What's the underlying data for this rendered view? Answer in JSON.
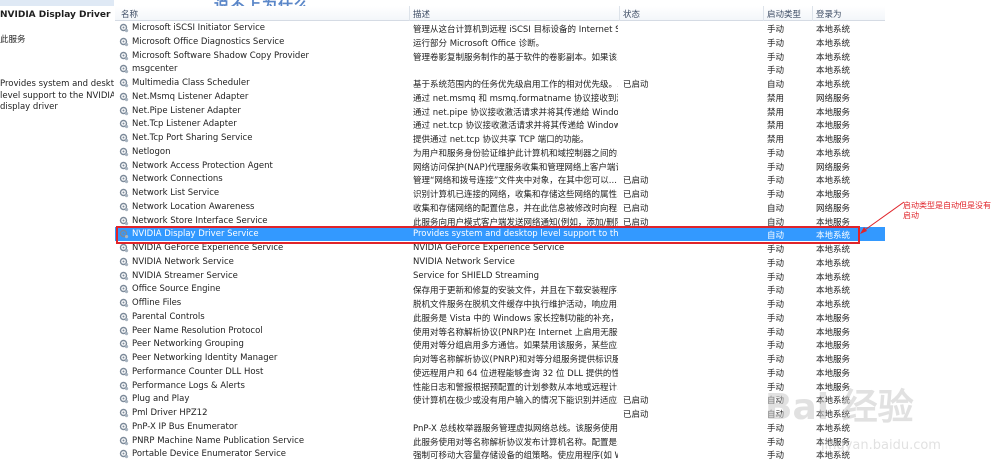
{
  "left_panel": {
    "title": "NVIDIA Display Driver Service",
    "link": "此服务",
    "description_lines": [
      "Provides system and desktop",
      "level support to the NVIDIA",
      "display driver"
    ]
  },
  "watermark_heading": "说不上为什么",
  "table": {
    "headers": {
      "name": "名称",
      "description": "描述",
      "status": "状态",
      "startup": "启动类型",
      "logon": "登录为"
    },
    "rows": [
      {
        "name": "Microsoft iSCSI Initiator Service",
        "description": "管理从这台计算机到远程 iSCSI 目标设备的 Internet SC...",
        "status": "",
        "startup": "手动",
        "logon": "本地系统"
      },
      {
        "name": "Microsoft Office Diagnostics Service",
        "description": "运行部分 Microsoft Office 诊断。",
        "status": "",
        "startup": "手动",
        "logon": "本地系统"
      },
      {
        "name": "Microsoft Software Shadow Copy Provider",
        "description": "管理卷影复制服务制作的基于软件的卷影副本。如果该...",
        "status": "",
        "startup": "手动",
        "logon": "本地系统"
      },
      {
        "name": "msgcenter",
        "description": "",
        "status": "",
        "startup": "手动",
        "logon": "本地系统"
      },
      {
        "name": "Multimedia Class Scheduler",
        "description": "基于系统范围内的任务优先级启用工作的相对优先级。...",
        "status": "已启动",
        "startup": "自动",
        "logon": "本地系统"
      },
      {
        "name": "Net.Msmq Listener Adapter",
        "description": "通过 net.msmq 和 msmq.formatname 协议接收到激...",
        "status": "",
        "startup": "禁用",
        "logon": "网络服务"
      },
      {
        "name": "Net.Pipe Listener Adapter",
        "description": "通过 net.pipe 协议接收激活请求并将其传递给 Window...",
        "status": "",
        "startup": "禁用",
        "logon": "本地服务"
      },
      {
        "name": "Net.Tcp Listener Adapter",
        "description": "通过 net.tcp 协议接收激活请求并将其传递给 Windows...",
        "status": "",
        "startup": "禁用",
        "logon": "本地服务"
      },
      {
        "name": "Net.Tcp Port Sharing Service",
        "description": "提供通过 net.tcp 协议共享 TCP 端口的功能。",
        "status": "",
        "startup": "禁用",
        "logon": "本地服务"
      },
      {
        "name": "Netlogon",
        "description": "为用户和服务身份验证维护此计算机和域控制器之间的...",
        "status": "",
        "startup": "手动",
        "logon": "本地系统"
      },
      {
        "name": "Network Access Protection Agent",
        "description": "网络访问保护(NAP)代理服务收集和管理网络上客户端计...",
        "status": "",
        "startup": "手动",
        "logon": "网络服务"
      },
      {
        "name": "Network Connections",
        "description": "管理“网络和拨号连接”文件夹中对象，在其中您可以...",
        "status": "已启动",
        "startup": "手动",
        "logon": "本地系统"
      },
      {
        "name": "Network List Service",
        "description": "识别计算机已连接的网络，收集和存储这些网络的属性...",
        "status": "已启动",
        "startup": "手动",
        "logon": "本地服务"
      },
      {
        "name": "Network Location Awareness",
        "description": "收集和存储网络的配置信息，并在此信息被修改时向程...",
        "status": "已启动",
        "startup": "自动",
        "logon": "网络服务"
      },
      {
        "name": "Network Store Interface Service",
        "description": "此服务向用户模式客户端发送网络通知(例如，添加/删除...",
        "status": "已启动",
        "startup": "自动",
        "logon": "本地服务"
      },
      {
        "name": "NVIDIA Display Driver Service",
        "description": "Provides system and desktop level support to the ...",
        "status": "",
        "startup": "自动",
        "logon": "本地系统",
        "selected": true
      },
      {
        "name": "NVIDIA GeForce Experience Service",
        "description": "NVIDIA GeForce Experience Service",
        "status": "",
        "startup": "手动",
        "logon": "本地系统"
      },
      {
        "name": "NVIDIA Network Service",
        "description": "NVIDIA Network Service",
        "status": "",
        "startup": "手动",
        "logon": "本地系统"
      },
      {
        "name": "NVIDIA Streamer Service",
        "description": "Service for SHIELD Streaming",
        "status": "",
        "startup": "手动",
        "logon": "本地系统"
      },
      {
        "name": "Office Source Engine",
        "description": "保存用于更新和修复的安装文件，并且在下载安装程序...",
        "status": "",
        "startup": "手动",
        "logon": "本地系统"
      },
      {
        "name": "Offline Files",
        "description": "脱机文件服务在脱机文件缓存中执行维护活动，响应用...",
        "status": "",
        "startup": "手动",
        "logon": "本地系统"
      },
      {
        "name": "Parental Controls",
        "description": "此服务是 Vista 中的 Windows 家长控制功能的补充，...",
        "status": "",
        "startup": "手动",
        "logon": "本地服务"
      },
      {
        "name": "Peer Name Resolution Protocol",
        "description": "使用对等名称解析协议(PNRP)在 Internet 上启用无服务...",
        "status": "",
        "startup": "手动",
        "logon": "本地服务"
      },
      {
        "name": "Peer Networking Grouping",
        "description": "使用对等分组启用多方通信。如果禁用该服务，某些应...",
        "status": "",
        "startup": "手动",
        "logon": "本地服务"
      },
      {
        "name": "Peer Networking Identity Manager",
        "description": "向对等名称解析协议(PNRP)和对等分组服务提供标识服...",
        "status": "",
        "startup": "手动",
        "logon": "本地服务"
      },
      {
        "name": "Performance Counter DLL Host",
        "description": "使远程用户和 64 位进程能够查询 32 位 DLL 提供的性...",
        "status": "",
        "startup": "手动",
        "logon": "本地服务"
      },
      {
        "name": "Performance Logs & Alerts",
        "description": "性能日志和警报根据预配置的计划参数从本地或远程计...",
        "status": "",
        "startup": "手动",
        "logon": "本地服务"
      },
      {
        "name": "Plug and Play",
        "description": "使计算机在极少或没有用户输入的情况下能识别并适应...",
        "status": "已启动",
        "startup": "自动",
        "logon": "本地系统"
      },
      {
        "name": "Pml Driver HPZ12",
        "description": "",
        "status": "已启动",
        "startup": "自动",
        "logon": "本地系统"
      },
      {
        "name": "PnP-X IP Bus Enumerator",
        "description": "PnP-X 总线枚举器服务管理虚拟网络总线。该服务使用 ...",
        "status": "",
        "startup": "手动",
        "logon": "本地系统"
      },
      {
        "name": "PNRP Machine Name Publication Service",
        "description": "此服务使用对等名称解析协议发布计算机名称。配置是...",
        "status": "",
        "startup": "手动",
        "logon": "本地服务"
      },
      {
        "name": "Portable Device Enumerator Service",
        "description": "强制可移动大容量存储设备的组策略。使应用程序(如 W...",
        "status": "",
        "startup": "手动",
        "logon": "本地系统"
      }
    ]
  },
  "annotation": {
    "text": "启动类型是自动但是没有启动",
    "color": "#e0242a"
  },
  "baidu_logo": {
    "main": "Bai 经验",
    "url": "jingyan.baidu.com"
  },
  "colors": {
    "selection": "#3399ff",
    "highlight_border": "#e0242a"
  }
}
